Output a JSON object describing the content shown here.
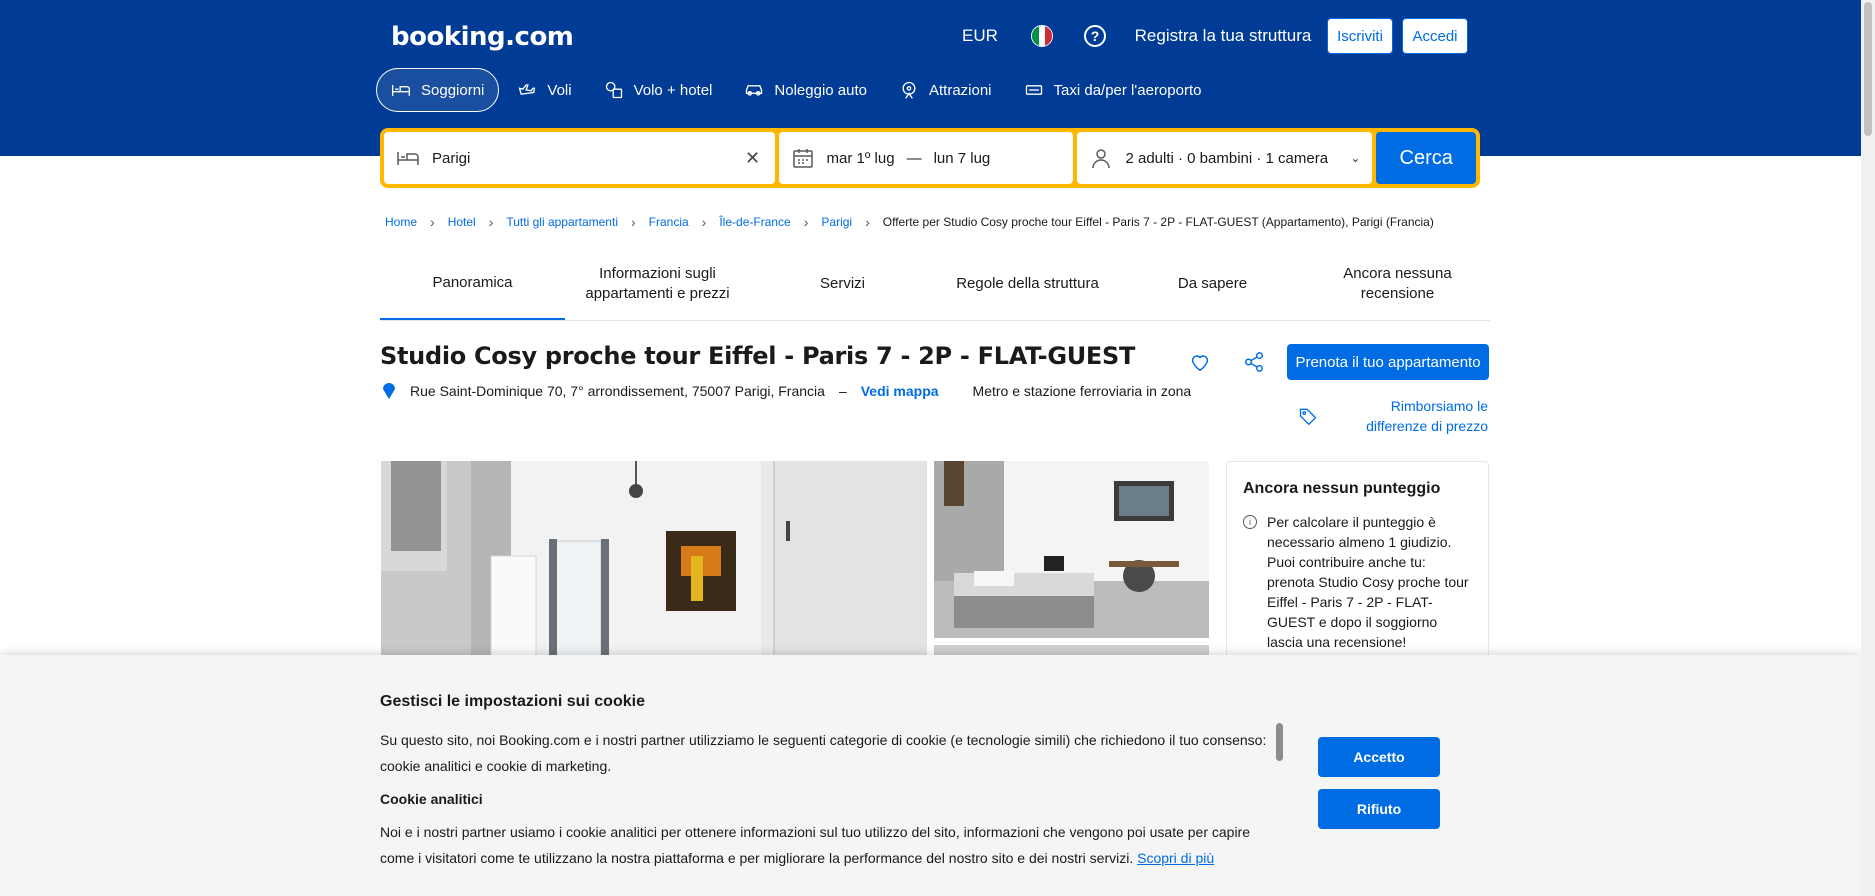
{
  "header": {
    "logo": "booking.com",
    "currency": "EUR",
    "language_flag": "italian-flag",
    "help_icon": "?",
    "register_property": "Registra la tua struttura",
    "signup": "Iscriviti",
    "login": "Accedi",
    "colors": {
      "brand": "#003b95",
      "accent": "#006ce4",
      "search_border": "#ffb700"
    }
  },
  "nav": {
    "tabs": [
      {
        "label": "Soggiorni",
        "icon": "bed-icon",
        "active": true
      },
      {
        "label": "Voli",
        "icon": "plane-icon"
      },
      {
        "label": "Volo + hotel",
        "icon": "flight-hotel-icon"
      },
      {
        "label": "Noleggio auto",
        "icon": "car-icon"
      },
      {
        "label": "Attrazioni",
        "icon": "attractions-icon"
      },
      {
        "label": "Taxi da/per l'aeroporto",
        "icon": "taxi-icon"
      }
    ]
  },
  "search": {
    "destination": "Parigi",
    "dates_from": "mar 1º lug",
    "dates_sep": "—",
    "dates_to": "lun 7 lug",
    "guests": "2 adulti · 0 bambini · 1 camera",
    "button": "Cerca"
  },
  "breadcrumbs": {
    "items": [
      "Home",
      "Hotel",
      "Tutti gli appartamenti",
      "Francia",
      "Île-de-France",
      "Parigi"
    ],
    "current": "Offerte per Studio Cosy proche tour Eiffel - Paris 7 - 2P - FLAT-GUEST (Appartamento), Parigi (Francia)"
  },
  "property_tabs": [
    {
      "label": "Panoramica",
      "active": true
    },
    {
      "label": "Informazioni sugli appartamenti e prezzi"
    },
    {
      "label": "Servizi"
    },
    {
      "label": "Regole della struttura"
    },
    {
      "label": "Da sapere"
    },
    {
      "label": "Ancora nessuna recensione"
    }
  ],
  "property": {
    "title": "Studio Cosy proche tour Eiffel - Paris 7 - 2P - FLAT-GUEST",
    "address": "Rue Saint-Dominique 70, 7° arrondissement, 75007 Parigi, Francia",
    "separator": "–",
    "map_link": "Vedi mappa",
    "transport": "Metro e stazione ferroviaria in zona",
    "reserve_button": "Prenota il tuo appartamento",
    "price_match": "Rimborsiamo le differenze di prezzo"
  },
  "review": {
    "title": "Ancora nessun punteggio",
    "text": "Per calcolare il punteggio è necessario almeno 1 giudizio. Puoi contribuire anche tu: prenota Studio Cosy proche tour Eiffel - Paris 7 - 2P - FLAT-GUEST e dopo il soggiorno lascia una recensione!"
  },
  "cookie": {
    "title": "Gestisci le impostazioni sui cookie",
    "intro": "Su questo sito, noi Booking.com e i nostri partner utilizziamo le seguenti categorie di cookie (e tecnologie simili) che richiedono il tuo consenso: cookie analitici e cookie di marketing.",
    "analytics_title": "Cookie analitici",
    "analytics_text": "Noi e i nostri partner usiamo i cookie analitici per ottenere informazioni sul tuo utilizzo del sito, informazioni che vengono poi usate per capire come i visitatori come te utilizzano la nostra piattaforma e per migliorare la performance del nostro sito e dei nostri servizi.",
    "learn_more": "Scopri di più",
    "accept": "Accetto",
    "reject": "Rifiuto"
  }
}
